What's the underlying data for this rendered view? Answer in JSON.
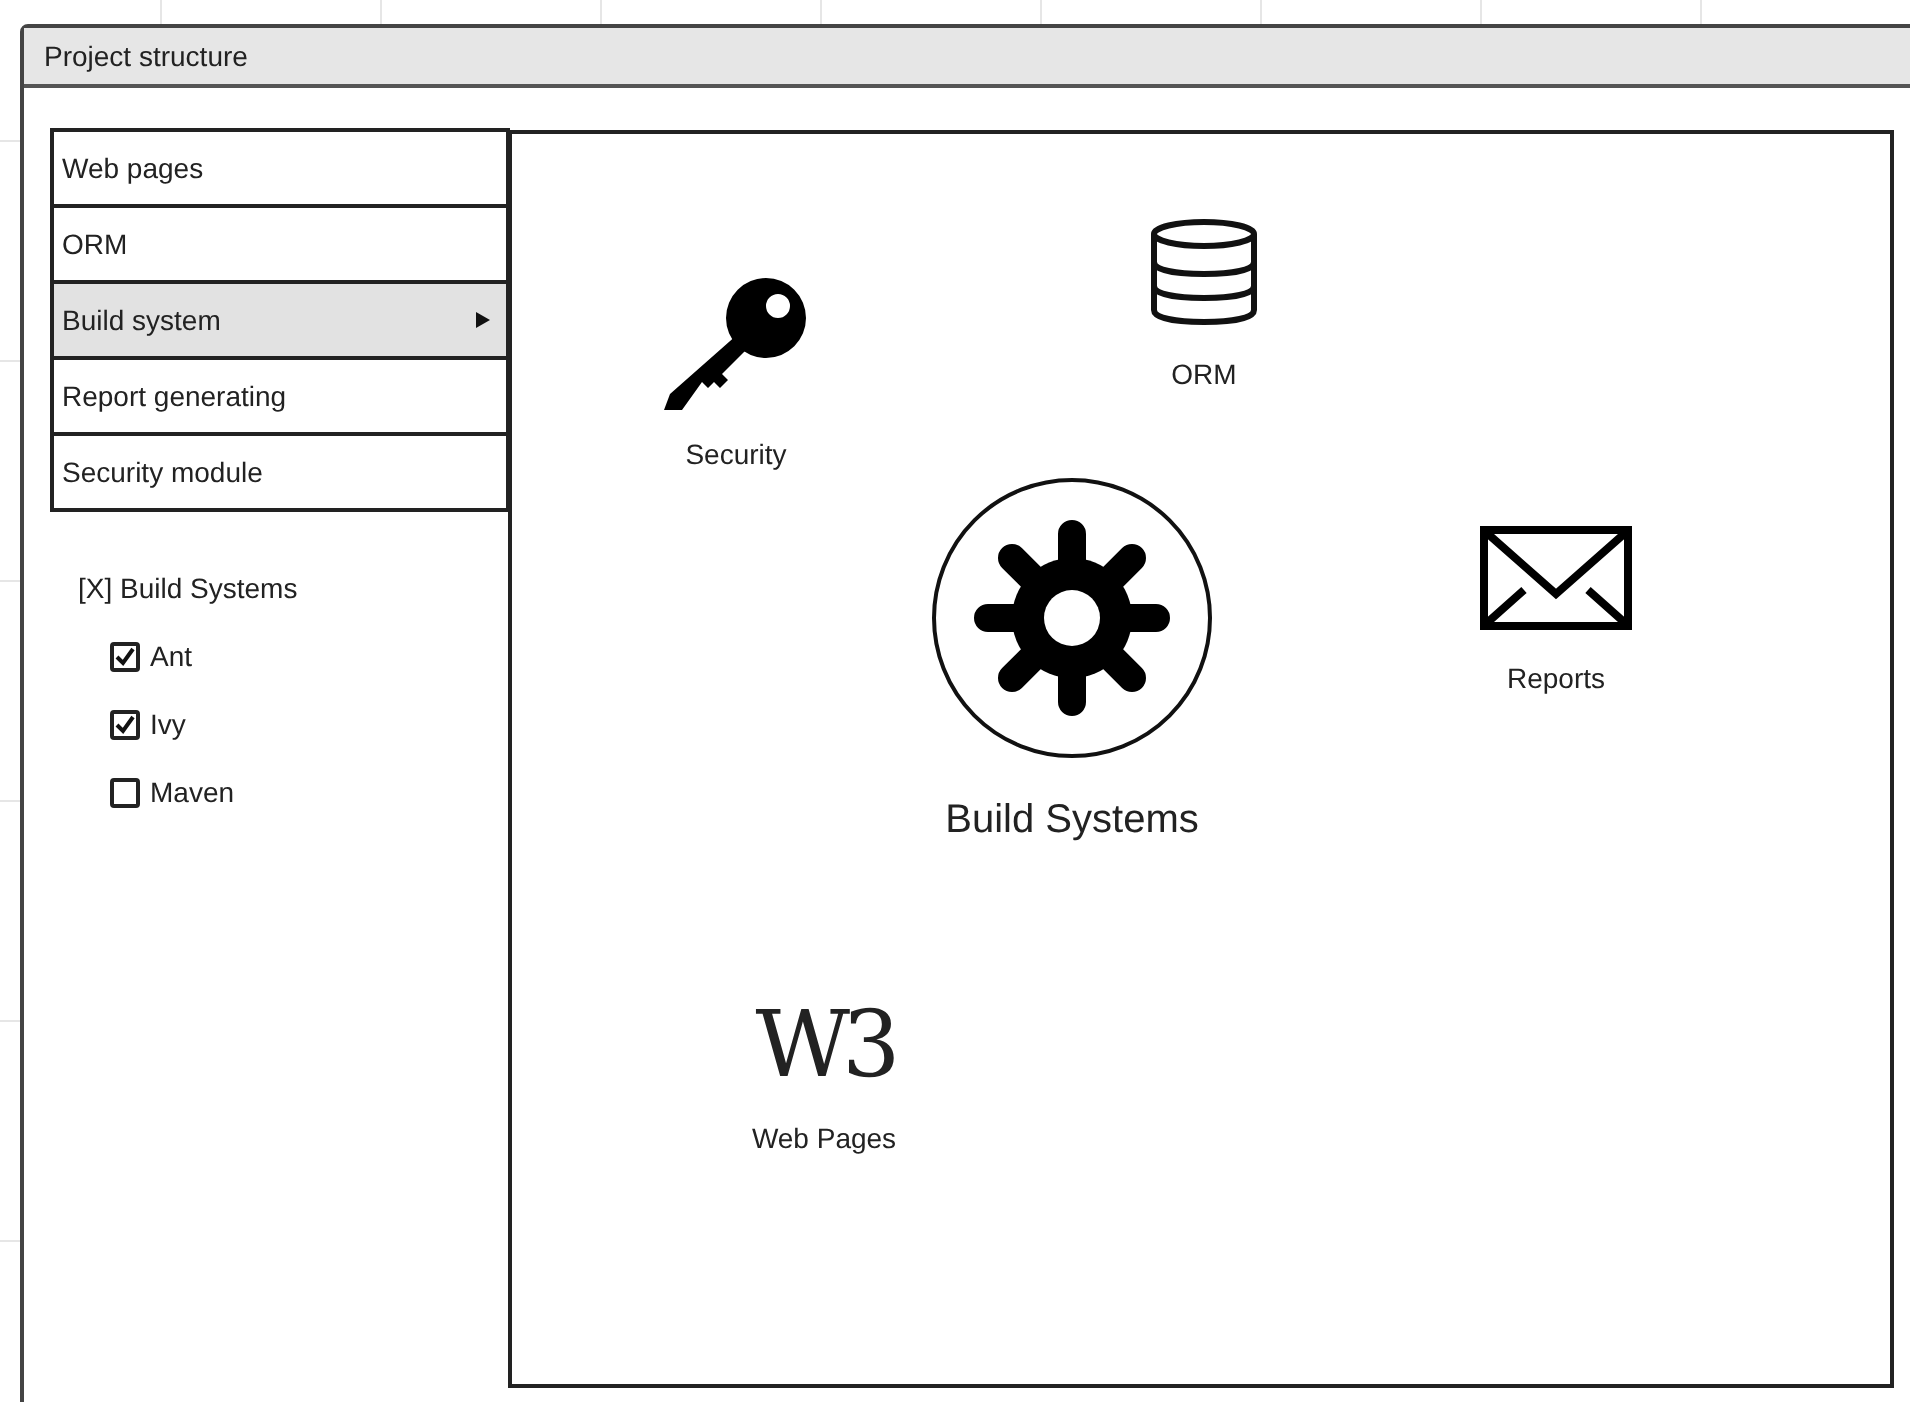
{
  "window": {
    "title": "Project structure"
  },
  "sidebar": {
    "items": [
      {
        "label": "Web pages",
        "selected": false,
        "submenu": false
      },
      {
        "label": "ORM",
        "selected": false,
        "submenu": false
      },
      {
        "label": "Build system",
        "selected": true,
        "submenu": true
      },
      {
        "label": "Report generating",
        "selected": false,
        "submenu": false
      },
      {
        "label": "Security module",
        "selected": false,
        "submenu": false
      }
    ]
  },
  "options": {
    "heading": "[X] Build Systems",
    "items": [
      {
        "label": "Ant",
        "checked": true
      },
      {
        "label": "Ivy",
        "checked": true
      },
      {
        "label": "Maven",
        "checked": false
      }
    ]
  },
  "canvas": {
    "nodes": [
      {
        "kind": "key",
        "label": "Security"
      },
      {
        "kind": "database",
        "label": "ORM"
      },
      {
        "kind": "gear",
        "label": "Build Systems"
      },
      {
        "kind": "envelope",
        "label": "Reports"
      },
      {
        "kind": "logo",
        "logo": "W3",
        "label": "Web Pages"
      }
    ]
  }
}
